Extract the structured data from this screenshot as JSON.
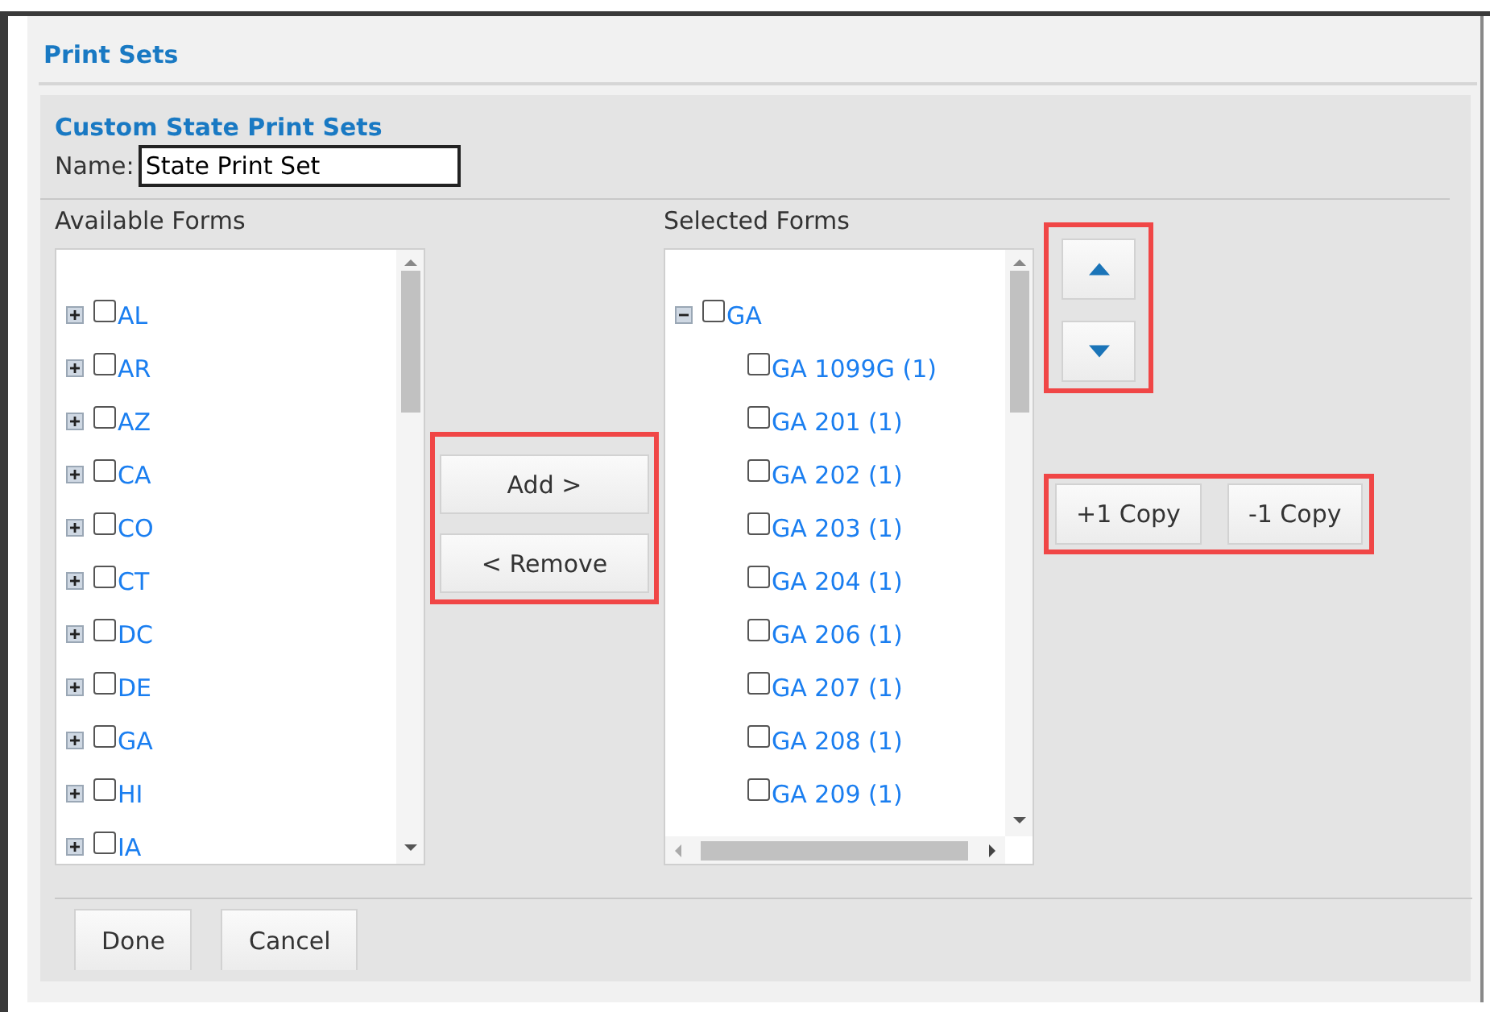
{
  "window": {
    "title": "Print Sets"
  },
  "section_title": "Custom State Print Sets",
  "name_field": {
    "label": "Name:",
    "value": "State Print Set"
  },
  "available_forms": {
    "heading": "Available Forms",
    "items": [
      {
        "label": "AL",
        "checked": false,
        "expanded": false
      },
      {
        "label": "AR",
        "checked": false,
        "expanded": false
      },
      {
        "label": "AZ",
        "checked": false,
        "expanded": false
      },
      {
        "label": "CA",
        "checked": false,
        "expanded": false
      },
      {
        "label": "CO",
        "checked": false,
        "expanded": false
      },
      {
        "label": "CT",
        "checked": false,
        "expanded": false
      },
      {
        "label": "DC",
        "checked": false,
        "expanded": false
      },
      {
        "label": "DE",
        "checked": false,
        "expanded": false
      },
      {
        "label": "GA",
        "checked": false,
        "expanded": false
      },
      {
        "label": "HI",
        "checked": false,
        "expanded": false
      },
      {
        "label": "IA",
        "checked": false,
        "expanded": false
      }
    ]
  },
  "transfer_buttons": [
    "Add >",
    "< Remove"
  ],
  "selected_forms": {
    "heading": "Selected Forms",
    "items": [
      {
        "label": "GA",
        "checked": false,
        "expanded": true,
        "children": [
          {
            "label": "GA 1099G (1)",
            "checked": false
          },
          {
            "label": "GA 201 (1)",
            "checked": false
          },
          {
            "label": "GA 202 (1)",
            "checked": false
          },
          {
            "label": "GA 203 (1)",
            "checked": false
          },
          {
            "label": "GA 204 (1)",
            "checked": false
          },
          {
            "label": "GA 206 (1)",
            "checked": false
          },
          {
            "label": "GA 207 (1)",
            "checked": false
          },
          {
            "label": "GA 208 (1)",
            "checked": false
          },
          {
            "label": "GA 209 (1)",
            "checked": false
          }
        ]
      }
    ]
  },
  "copy_buttons": [
    "+1 Copy",
    "-1 Copy"
  ],
  "footer_buttons": [
    "Done",
    "Cancel"
  ]
}
